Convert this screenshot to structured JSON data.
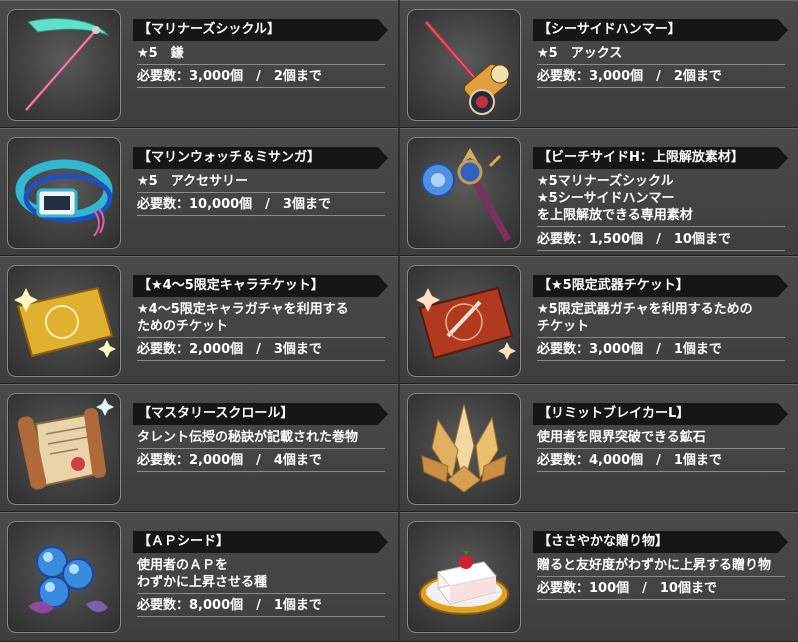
{
  "items": [
    {
      "title": "【マリナーズシックル】",
      "desc": "★5　鎌",
      "req": "必要数：3,000個　/　2個まで",
      "icon": "teal-scythe-icon"
    },
    {
      "title": "【シーサイドハンマー】",
      "desc": "★5　アックス",
      "req": "必要数：3,000個　/　2個まで",
      "icon": "hammer-icon"
    },
    {
      "title": "【マリンウォッチ＆ミサンガ】",
      "desc": "★5　アクセサリー",
      "req": "必要数：10,000個　/　3個まで",
      "icon": "watch-bracelet-icon"
    },
    {
      "title": "【ビーチサイドH：上限解放素材】",
      "desc": "★5マリナーズシックル\n★5シーサイドハンマー\nを上限解放できる専用素材",
      "req": "必要数：1,500個　/　10個まで",
      "icon": "staff-material-icon"
    },
    {
      "title": "【★4～5限定キャラチケット】",
      "desc": "★4～5限定キャラガチャを利用する\nためのチケット",
      "req": "必要数：2,000個　/　3個まで",
      "icon": "gold-ticket-icon"
    },
    {
      "title": "【★5限定武器チケット】",
      "desc": "★5限定武器ガチャを利用するための\nチケット",
      "req": "必要数：3,000個　/　1個まで",
      "icon": "red-ticket-icon"
    },
    {
      "title": "【マスタリースクロール】",
      "desc": "タレント伝授の秘訣が記載された巻物",
      "req": "必要数：2,000個　/　4個まで",
      "icon": "scroll-icon"
    },
    {
      "title": "【リミットブレイカーL】",
      "desc": "使用者を限界突破できる鉱石",
      "req": "必要数：4,000個　/　1個まで",
      "icon": "crystal-ore-icon"
    },
    {
      "title": "【ＡＰシード】",
      "desc": "使用者のＡＰを\nわずかに上昇させる種",
      "req": "必要数：8,000個　/　1個まで",
      "icon": "blue-seeds-icon"
    },
    {
      "title": "【ささやかな贈り物】",
      "desc": "贈ると友好度がわずかに上昇する贈り物",
      "req": "必要数：100個　/　10個まで",
      "icon": "cake-icon"
    }
  ]
}
